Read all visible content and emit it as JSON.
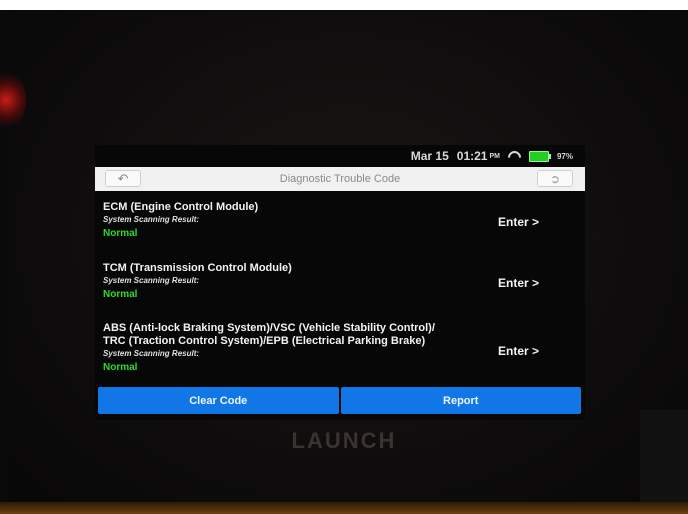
{
  "status": {
    "date": "Mar 15",
    "time": "01:21",
    "ampm": "PM",
    "battery": "97%"
  },
  "header": {
    "title": "Diagnostic Trouble Code"
  },
  "icons": {
    "back": "back-arrow-icon",
    "exit": "exit-icon",
    "wifi": "wifi-icon",
    "battery": "battery-icon"
  },
  "modules": [
    {
      "name_lines": [
        "ECM (Engine Control Module)"
      ],
      "scan_label": "System Scanning Result:",
      "result": "Normal",
      "action": "Enter >"
    },
    {
      "name_lines": [
        "TCM (Transmission Control Module)"
      ],
      "scan_label": "System Scanning Result:",
      "result": "Normal",
      "action": "Enter >"
    },
    {
      "name_lines": [
        "ABS (Anti-lock Braking System)/VSC (Vehicle Stability Control)/",
        "TRC (Traction Control System)/EPB (Electrical Parking Brake)"
      ],
      "scan_label": "System Scanning Result:",
      "result": "Normal",
      "action": "Enter >"
    }
  ],
  "footer": {
    "clear_label": "Clear Code",
    "report_label": "Report"
  },
  "device": {
    "brand": "LAUNCH"
  },
  "colors": {
    "accent": "#1177e6",
    "normal": "#2dd92d"
  }
}
